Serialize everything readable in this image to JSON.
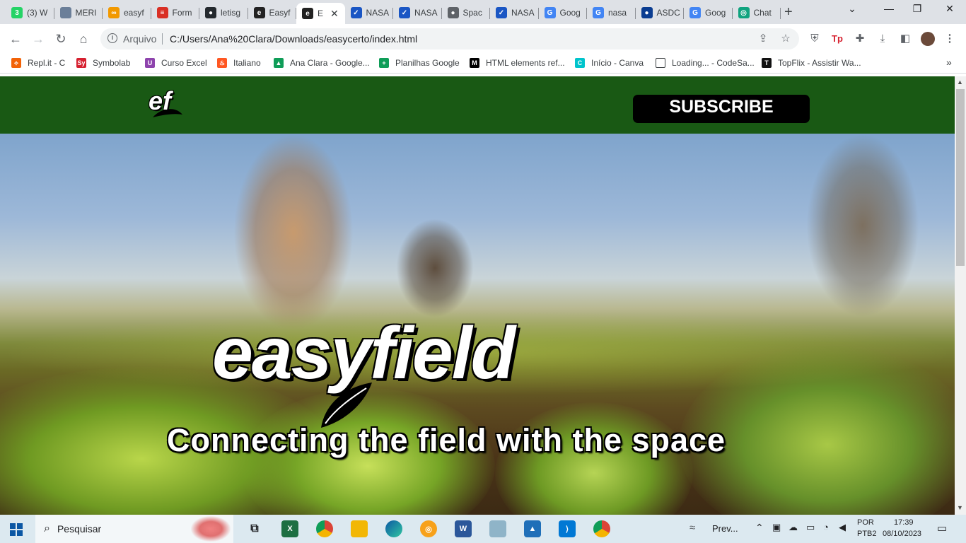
{
  "browser": {
    "tabs": [
      {
        "label": "(3) W",
        "icon": "whatsapp-icon",
        "color": "#25d366",
        "glyph": "3"
      },
      {
        "label": "MERI",
        "icon": "doc-icon",
        "color": "#6b7f99",
        "glyph": ""
      },
      {
        "label": "easyf",
        "icon": "infinity-icon",
        "color": "#f29900",
        "glyph": "∞"
      },
      {
        "label": "Form",
        "icon": "form-icon",
        "color": "#d93025",
        "glyph": "≡"
      },
      {
        "label": "letisg",
        "icon": "github-icon",
        "color": "#24292e",
        "glyph": "●"
      },
      {
        "label": "Easyf",
        "icon": "easyfield-icon",
        "color": "#222222",
        "glyph": "e"
      },
      {
        "label": "E",
        "icon": "easyfield-icon",
        "color": "#222222",
        "glyph": "e",
        "active": true
      },
      {
        "label": "NASA",
        "icon": "nasa-icon",
        "color": "#1a56c4",
        "glyph": "✓"
      },
      {
        "label": "NASA",
        "icon": "nasa-icon",
        "color": "#1a56c4",
        "glyph": "✓"
      },
      {
        "label": "Spac",
        "icon": "globe-icon",
        "color": "#5f6368",
        "glyph": "●"
      },
      {
        "label": "NASA",
        "icon": "nasa-icon",
        "color": "#1a56c4",
        "glyph": "✓"
      },
      {
        "label": "Goog",
        "icon": "google-translate-icon",
        "color": "#4285f4",
        "glyph": "G"
      },
      {
        "label": "nasa",
        "icon": "google-icon",
        "color": "#4285f4",
        "glyph": "G"
      },
      {
        "label": "ASDC",
        "icon": "nasa-meatball-icon",
        "color": "#0b3d91",
        "glyph": "●"
      },
      {
        "label": "Goog",
        "icon": "google-translate-icon",
        "color": "#4285f4",
        "glyph": "G"
      },
      {
        "label": "Chat",
        "icon": "chatgpt-icon",
        "color": "#10a37f",
        "glyph": "◎"
      }
    ],
    "address": {
      "security_label": "Arquivo",
      "url": "C:/Users/Ana%20Clara/Downloads/easycerto/index.html"
    },
    "bookmarks": [
      {
        "label": "Repl.it - C",
        "icon": "replit-icon",
        "color": "#f26207",
        "glyph": "⟡"
      },
      {
        "label": "Symbolab",
        "icon": "symbolab-icon",
        "color": "#d6202f",
        "glyph": "Sy"
      },
      {
        "label": "Curso Excel",
        "icon": "excel-course-icon",
        "color": "#8e44ad",
        "glyph": "U"
      },
      {
        "label": "Italiano",
        "icon": "flame-icon",
        "color": "#ff5722",
        "glyph": "♨"
      },
      {
        "label": "Ana Clara - Google...",
        "icon": "google-drive-icon",
        "color": "#0f9d58",
        "glyph": "▲"
      },
      {
        "label": "Planilhas Google",
        "icon": "google-sheets-icon",
        "color": "#0f9d58",
        "glyph": "+"
      },
      {
        "label": "HTML elements ref...",
        "icon": "mdn-icon",
        "color": "#000000",
        "glyph": "M"
      },
      {
        "label": "Início - Canva",
        "icon": "canva-icon",
        "color": "#00c4cc",
        "glyph": "C"
      },
      {
        "label": "Loading... - CodeSa...",
        "icon": "page-icon",
        "color": "#ffffff",
        "glyph": ""
      },
      {
        "label": "TopFlix - Assistir Wa...",
        "icon": "topflix-icon",
        "color": "#111111",
        "glyph": "T"
      }
    ]
  },
  "site": {
    "header_logo_text": "ef",
    "subscribe_label": "SUBSCRIBE",
    "brand": "easyfield",
    "tagline": "Connecting the field with the space"
  },
  "taskbar": {
    "search_placeholder": "Pesquisar",
    "weather_label": "Prev...",
    "lang_top": "POR",
    "lang_bottom": "PTB2",
    "time": "17:39",
    "date": "08/10/2023"
  }
}
